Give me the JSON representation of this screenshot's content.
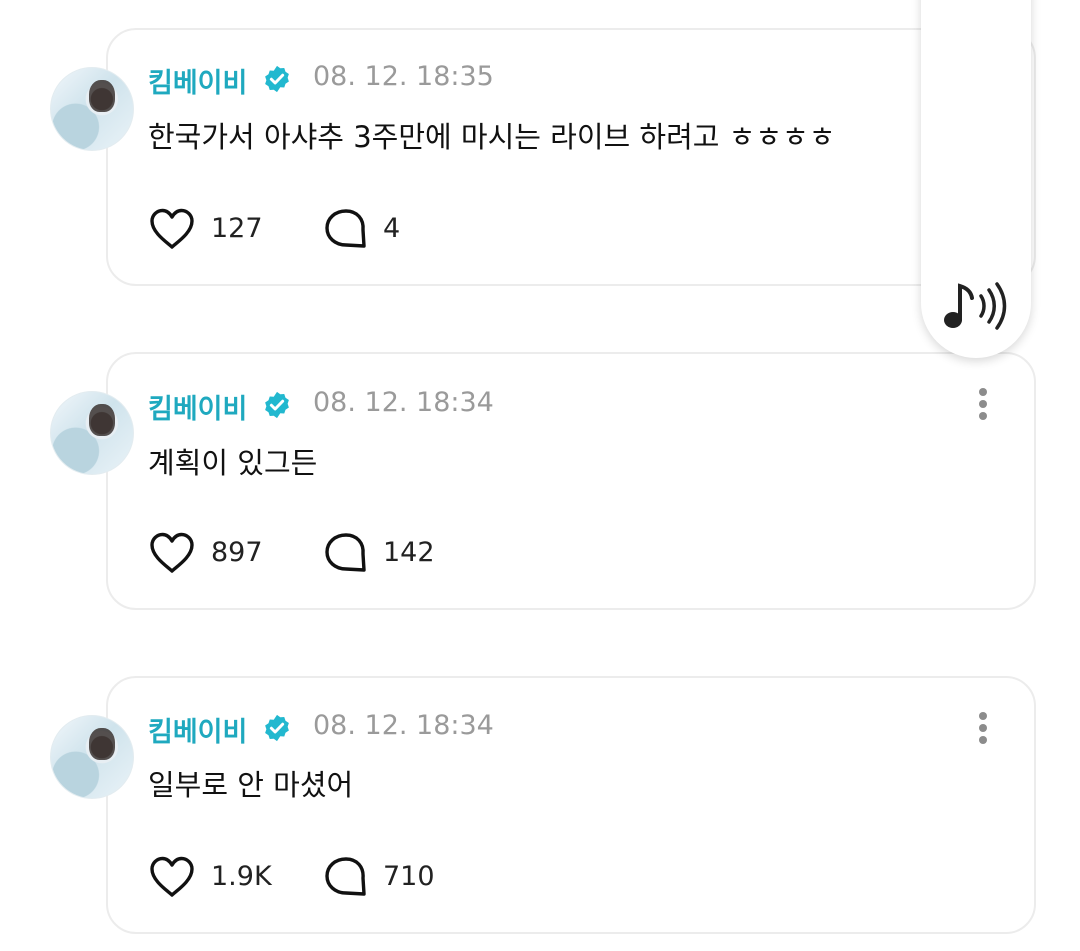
{
  "posts": [
    {
      "author": "킴베이비",
      "time": "08. 12. 18:35",
      "text": "한국가서 아샤추 3주만에 마시는 라이브 하려고 ㅎㅎㅎㅎ",
      "likes": "127",
      "comments": "4"
    },
    {
      "author": "킴베이비",
      "time": "08. 12. 18:34",
      "text": "계획이 있그든",
      "likes": "897",
      "comments": "142"
    },
    {
      "author": "킴베이비",
      "time": "08. 12. 18:34",
      "text": "일부로 안 마셨어",
      "likes": "1.9K",
      "comments": "710"
    }
  ],
  "icons": {
    "verified": "verified-badge-icon",
    "like": "heart-icon",
    "comment": "comment-bubble-icon",
    "more": "more-vertical-icon",
    "audio": "music-sound-icon"
  },
  "colors": {
    "author": "#1fa9bf",
    "timestamp": "#9a9a9a",
    "card_border": "#ececec"
  }
}
